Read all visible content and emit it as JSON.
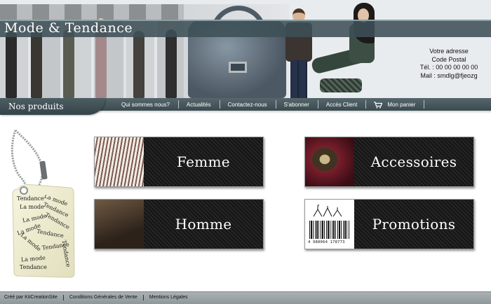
{
  "header": {
    "site_title": "Mode & Tendance",
    "contact": {
      "address": "Votre adresse",
      "postal": "Code Postal",
      "phone": "Tél. : 00 00 00 00 00",
      "mail": "Mail : smdlg@fjeozg"
    }
  },
  "nav": {
    "section_label": "Nos produits",
    "items": [
      {
        "label": "Qui sommes nous?"
      },
      {
        "label": "Actualités"
      },
      {
        "label": "Contactez-nous"
      },
      {
        "label": "S'abonner"
      },
      {
        "label": "Accès Client"
      },
      {
        "label": "Mon panier",
        "icon": "cart-icon"
      }
    ]
  },
  "tag": {
    "words": [
      "Tendance",
      "La mode",
      "La mode",
      "Tendance",
      "La mode",
      "Tendance",
      "La mode",
      "Tendance",
      "La mode",
      "Tendance",
      "Tendance",
      "La mode",
      "Tendance"
    ]
  },
  "categories": [
    {
      "label": "Femme"
    },
    {
      "label": "Accessoires"
    },
    {
      "label": "Homme"
    },
    {
      "label": "Promotions",
      "barcode_number": "4 988064 178773"
    }
  ],
  "footer": {
    "links": [
      {
        "label": "Créé par KitCreationSite"
      },
      {
        "label": "Conditions Générales de Vente"
      },
      {
        "label": "Mentions Légales"
      }
    ]
  },
  "colors": {
    "band": "#3e5056",
    "nav": "#455559",
    "card": "#1a1a1a",
    "footer": "#9aa2a6"
  }
}
